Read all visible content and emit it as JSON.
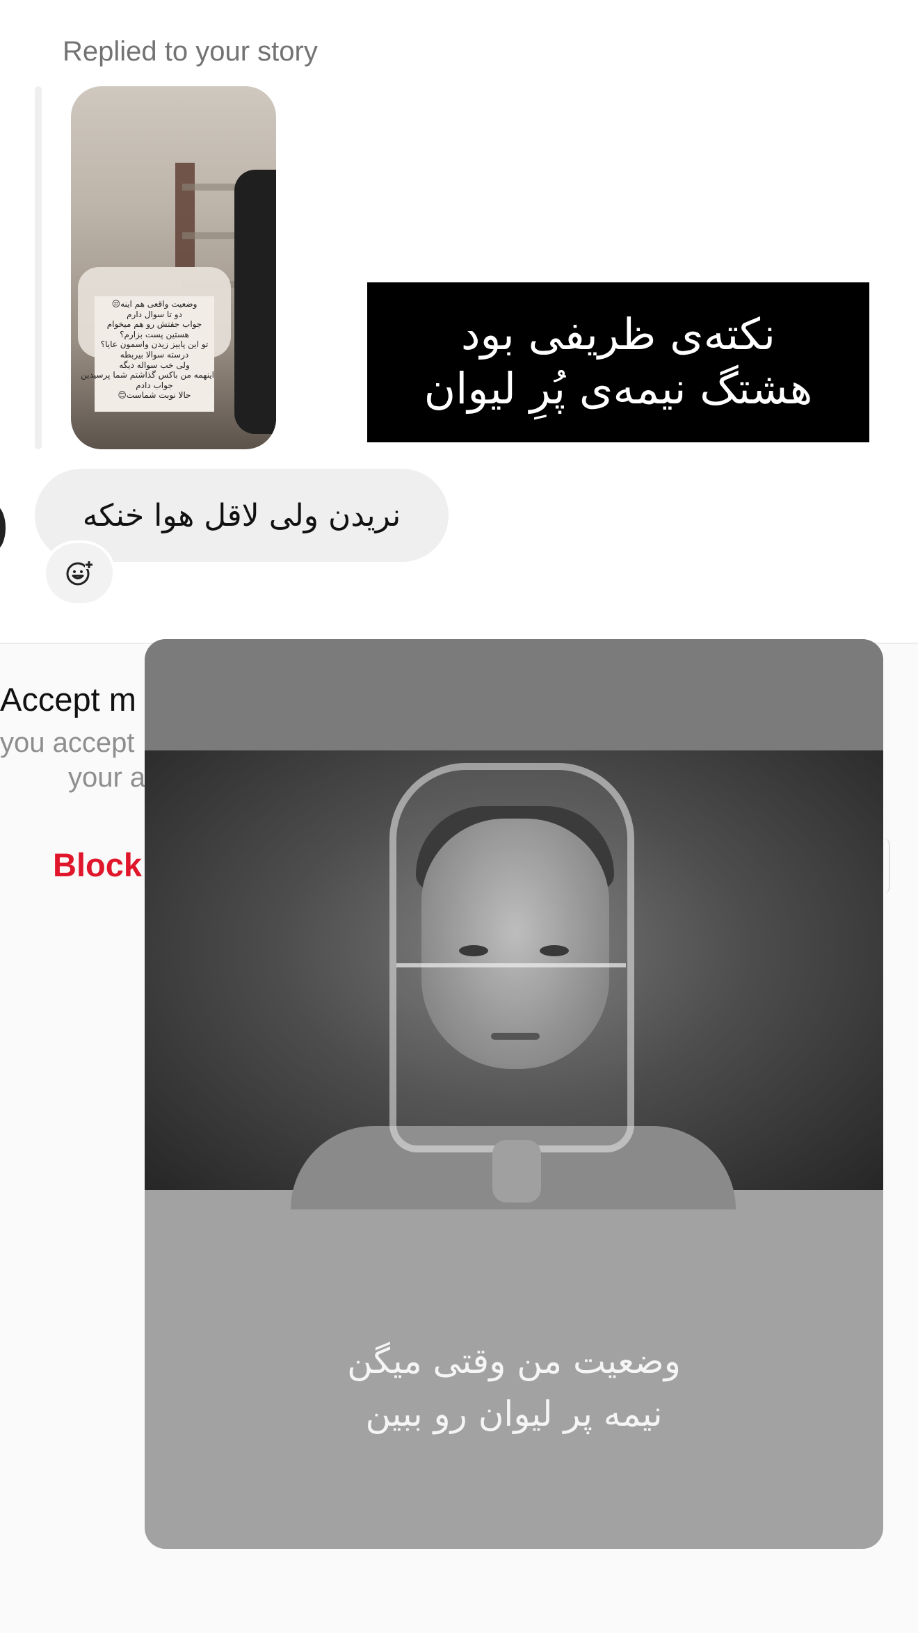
{
  "reply_header": {
    "label": "Replied to your story"
  },
  "story_thumbnail": {
    "note_lines": [
      "وضعیت واقعی هم اینه😒",
      "دو تا سوال دارم",
      "جواب جفتش رو هم میخوام",
      "هستین پست بزارم؟",
      "تو این پاییز زیدن واسمون عایا؟",
      "درسته سوالا بیربطه",
      "ولی خب سواله دیگه",
      "اینهمه من باکس گذاشتم شما پرسیدین",
      "جواب دادم",
      "حالا نوبت شماست😊"
    ]
  },
  "banner": {
    "line1": "نکته‌ی ظریفی بود",
    "line2": "هشتگ نیمه‌ی پُرِ لیوان"
  },
  "message": {
    "text": "نریدن ولی لاقل هوا خنکه",
    "react_icon": "add-reaction-icon"
  },
  "request": {
    "title": "Accept m",
    "desc_line1": "you accept",
    "desc_line2": "your a",
    "block_label": "Block"
  },
  "shared_post": {
    "caption_line1": "وضعیت من وقتی میگن",
    "caption_line2": "نیمه پر لیوان رو ببین"
  },
  "colors": {
    "block_red": "#e0162b",
    "bubble_gray": "#efefef",
    "muted_text": "#737373"
  }
}
